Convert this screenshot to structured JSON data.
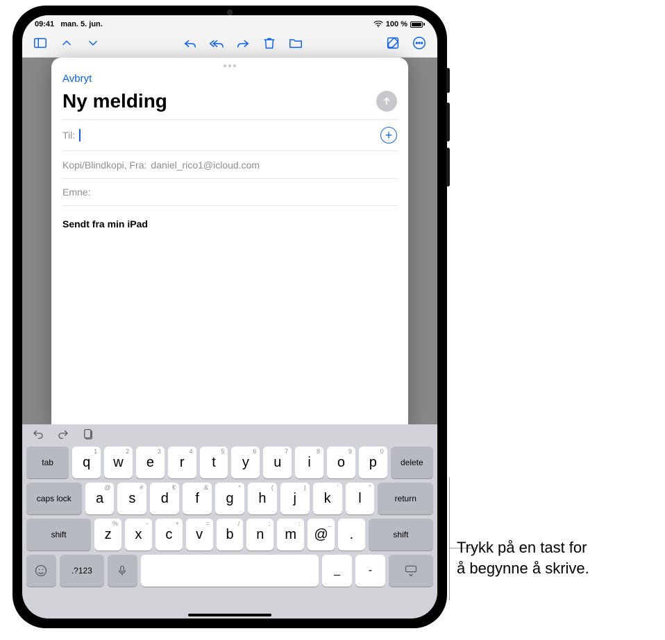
{
  "statusbar": {
    "time": "09:41",
    "date": "man. 5. jun.",
    "battery_text": "100 %"
  },
  "toolbar_icons": {
    "sidebar": "sidebar-icon",
    "chevron_up": "chevron-up-icon",
    "chevron_down": "chevron-down-icon",
    "reply": "reply-icon",
    "reply_all": "reply-all-icon",
    "forward": "forward-icon",
    "trash": "trash-icon",
    "folder": "folder-icon",
    "compose": "compose-icon",
    "more": "more-icon"
  },
  "compose": {
    "cancel": "Avbryt",
    "title": "Ny melding",
    "to_label": "Til:",
    "cc_label": "Kopi/Blindkopi, Fra:",
    "cc_value": "daniel_rico1@icloud.com",
    "subject_label": "Emne:",
    "signature": "Sendt fra min iPad"
  },
  "keyboard": {
    "row1": [
      {
        "k": "q",
        "h": "1"
      },
      {
        "k": "w",
        "h": "2"
      },
      {
        "k": "e",
        "h": "3"
      },
      {
        "k": "r",
        "h": "4"
      },
      {
        "k": "t",
        "h": "5"
      },
      {
        "k": "y",
        "h": "6"
      },
      {
        "k": "u",
        "h": "7"
      },
      {
        "k": "i",
        "h": "8"
      },
      {
        "k": "o",
        "h": "9"
      },
      {
        "k": "p",
        "h": "0"
      }
    ],
    "row2": [
      {
        "k": "a",
        "h": "@"
      },
      {
        "k": "s",
        "h": "#"
      },
      {
        "k": "d",
        "h": "€"
      },
      {
        "k": "f",
        "h": "&"
      },
      {
        "k": "g",
        "h": "*"
      },
      {
        "k": "h",
        "h": "("
      },
      {
        "k": "j",
        "h": ")"
      },
      {
        "k": "k",
        "h": "'"
      },
      {
        "k": "l",
        "h": "\""
      }
    ],
    "row3": [
      {
        "k": "z",
        "h": "%"
      },
      {
        "k": "x",
        "h": "-"
      },
      {
        "k": "c",
        "h": "+"
      },
      {
        "k": "v",
        "h": "="
      },
      {
        "k": "b",
        "h": "/"
      },
      {
        "k": "n",
        "h": ";"
      },
      {
        "k": "m",
        "h": ":"
      },
      {
        "k": "@",
        "h": "_"
      },
      {
        "k": ".",
        "h": ""
      }
    ],
    "tab": "tab",
    "delete": "delete",
    "caps": "caps lock",
    "return": "return",
    "shift": "shift",
    "numsym": ".?123",
    "underscore": "_",
    "dash": "-"
  },
  "callout": {
    "line1": "Trykk på en tast for",
    "line2": "å begynne å skrive."
  }
}
